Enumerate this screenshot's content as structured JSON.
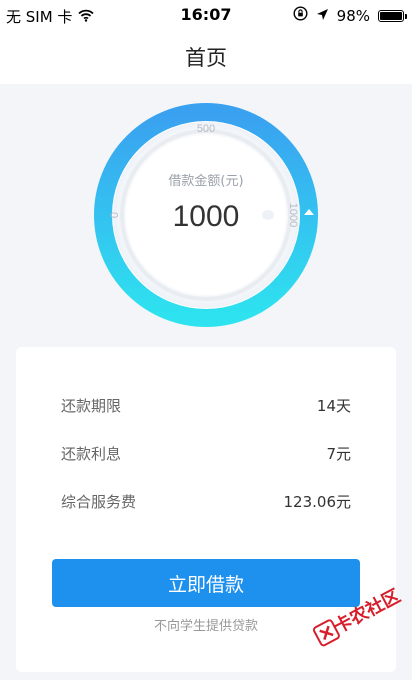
{
  "status_bar": {
    "carrier": "无 SIM 卡",
    "time": "16:07",
    "battery_text": "98%",
    "battery_level": 0.98,
    "icons": [
      "wifi-icon",
      "orientation-lock-icon",
      "location-arrow-icon",
      "battery-icon"
    ]
  },
  "nav": {
    "title": "首页"
  },
  "dial": {
    "label": "借款金额(元)",
    "amount": "1000",
    "tick_min": "0",
    "tick_mid": "500",
    "tick_max": "1000",
    "slider_value": 1000,
    "ring_colors": [
      "#3aa0f0",
      "#2ee3ef"
    ]
  },
  "details": {
    "rows": [
      {
        "label": "还款期限",
        "value": "14天"
      },
      {
        "label": "还款利息",
        "value": "7元"
      },
      {
        "label": "综合服务费",
        "value": "123.06元"
      }
    ]
  },
  "actions": {
    "borrow_button": "立即借款"
  },
  "notice": "不向学生提供贷款",
  "watermark": {
    "text": "卡农社区",
    "color": "#d81e2b"
  }
}
